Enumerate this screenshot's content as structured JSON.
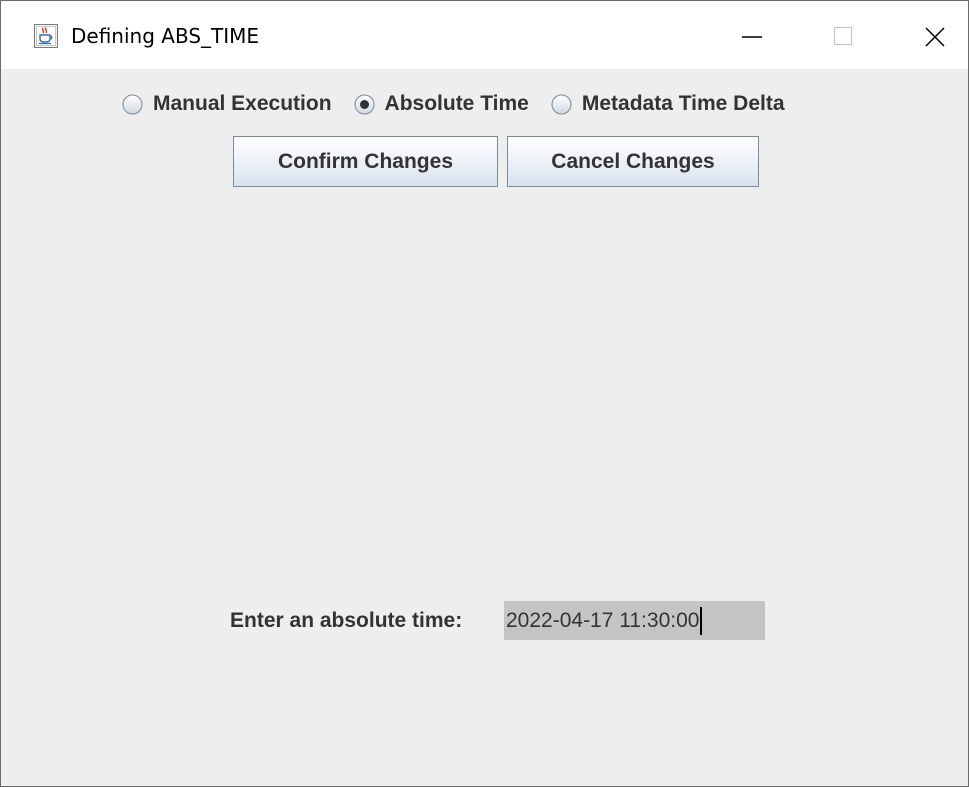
{
  "window": {
    "title": "Defining ABS_TIME",
    "icon": "java-coffee-cup-icon"
  },
  "mode": {
    "options": [
      {
        "label": "Manual Execution",
        "selected": false
      },
      {
        "label": "Absolute Time",
        "selected": true
      },
      {
        "label": "Metadata Time Delta",
        "selected": false
      }
    ]
  },
  "actions": {
    "confirm_label": "Confirm Changes",
    "cancel_label": "Cancel Changes"
  },
  "absolute_time": {
    "label": "Enter an absolute time:",
    "value": "2022-04-17 11:30:00"
  },
  "colors": {
    "panel_background": "#eeeeee",
    "titlebar_background": "#ffffff",
    "input_background": "#c4c4c4",
    "text": "#333333"
  }
}
